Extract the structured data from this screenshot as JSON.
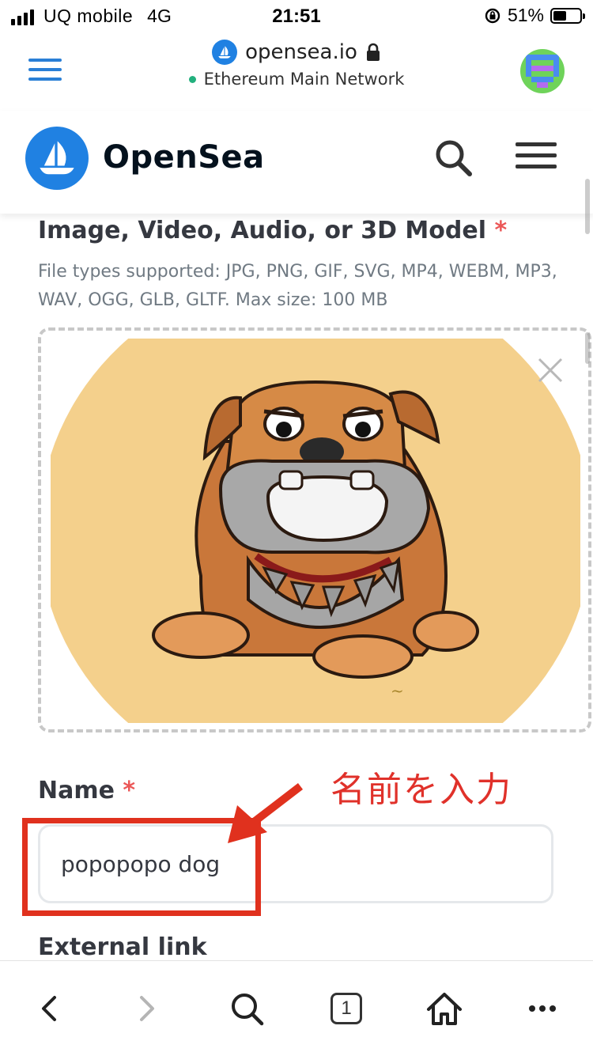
{
  "status_bar": {
    "carrier": "UQ mobile",
    "network": "4G",
    "time": "21:51",
    "battery_percent": "51%",
    "battery_level": 0.51
  },
  "browser": {
    "domain": "opensea.io",
    "network_name": "Ethereum Main Network"
  },
  "site": {
    "brand": "OpenSea"
  },
  "upload": {
    "title": "Image, Video, Audio, or 3D Model",
    "required_mark": "*",
    "hint": "File types supported: JPG, PNG, GIF, SVG, MP4, WEBM, MP3, WAV, OGG, GLB, GLTF. Max size: 100 MB"
  },
  "form": {
    "name_label": "Name",
    "name_required": "*",
    "name_value": "popopopo dog",
    "external_link_label": "External link"
  },
  "annotation": {
    "text": "名前を入力"
  },
  "toolbar": {
    "tab_count": "1"
  },
  "colors": {
    "accent": "#2081e2",
    "required": "#eb5757",
    "annotation_red": "#e0311e",
    "preview_background": "#f4d08c"
  }
}
